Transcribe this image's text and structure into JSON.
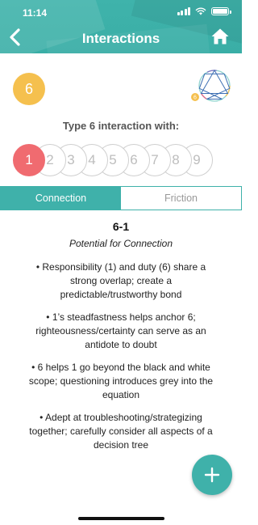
{
  "status_bar": {
    "time": "11:14"
  },
  "header": {
    "title": "Interactions"
  },
  "type_badge": "6",
  "subtitle": "Type 6 interaction with:",
  "type_options": [
    "1",
    "2",
    "3",
    "4",
    "5",
    "6",
    "7",
    "8",
    "9"
  ],
  "selected_type": "1",
  "enneagram_badge": "6",
  "tabs": [
    {
      "label": "Connection",
      "active": true
    },
    {
      "label": "Friction",
      "active": false
    }
  ],
  "content": {
    "heading": "6-1",
    "caption": "Potential for Connection",
    "bullets": [
      "• Responsibility (1) and duty (6) share a strong overlap; create a predictable/trustworthy bond",
      "• 1’s steadfastness helps anchor 6; righteousness/certainty can serve as an antidote to doubt",
      "• 6 helps 1 go beyond the black and white scope; questioning introduces grey into the equation",
      "• Adept at troubleshooting/strategizing together; carefully consider all aspects of a decision tree"
    ]
  },
  "fab": {
    "label": "+"
  },
  "colors": {
    "teal": "#3fb1aa",
    "badge_yellow": "#f5c04e",
    "selected_red": "#f06b70"
  }
}
